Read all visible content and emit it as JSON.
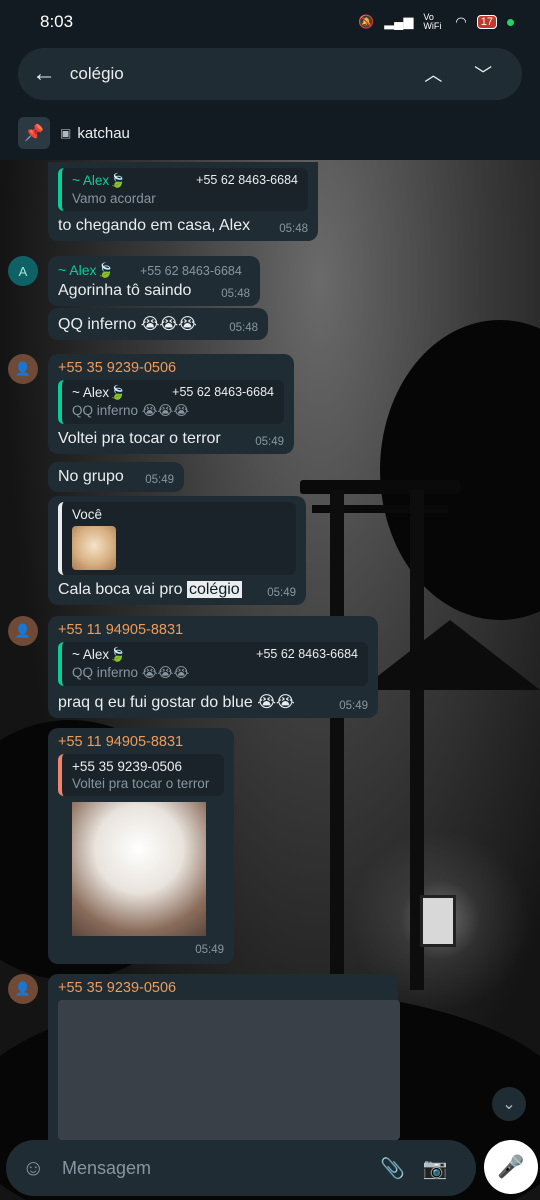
{
  "status_bar": {
    "time": "8:03",
    "signal": "Vo WiFi",
    "battery": "17"
  },
  "search": {
    "value": "colégio"
  },
  "pinned": {
    "label": "katchau"
  },
  "messages": {
    "m1": {
      "quote_name": "~ Alex🍃",
      "quote_number": "+55 62 8463-6684",
      "quote_text": "Vamo acordar",
      "text": "to chegando em casa, Alex",
      "time": "05:48"
    },
    "m2": {
      "avatar_letter": "A",
      "sender": "~ Alex🍃",
      "sender_number": "+55 62 8463-6684",
      "text": "Agorinha tô saindo",
      "time": "05:48"
    },
    "m3": {
      "text": "QQ inferno 😭😭😭",
      "time": "05:48"
    },
    "m4": {
      "sender": "+55 35 9239-0506",
      "quote_name": "~ Alex🍃",
      "quote_number": "+55 62 8463-6684",
      "quote_text": "QQ inferno 😭😭😭",
      "text": "Voltei pra tocar o terror",
      "time": "05:49"
    },
    "m5": {
      "text": "No grupo",
      "time": "05:49"
    },
    "m6": {
      "quote_name": "Você",
      "text_before": "Cala boca vai pro ",
      "text_highlight": "colégio",
      "time": "05:49"
    },
    "m7": {
      "sender": "+55 11 94905-8831",
      "quote_name": "~ Alex🍃",
      "quote_number": "+55 62 8463-6684",
      "quote_text": "QQ inferno 😭😭😭",
      "text": "praq q eu fui gostar do blue 😭😭",
      "time": "05:49"
    },
    "m8": {
      "sender": "+55 11 94905-8831",
      "quote_name": "+55 35 9239-0506",
      "quote_text": "Voltei pra tocar o terror",
      "time": "05:49"
    },
    "m9": {
      "sender": "+55 35 9239-0506"
    }
  },
  "composer": {
    "placeholder": "Mensagem"
  }
}
